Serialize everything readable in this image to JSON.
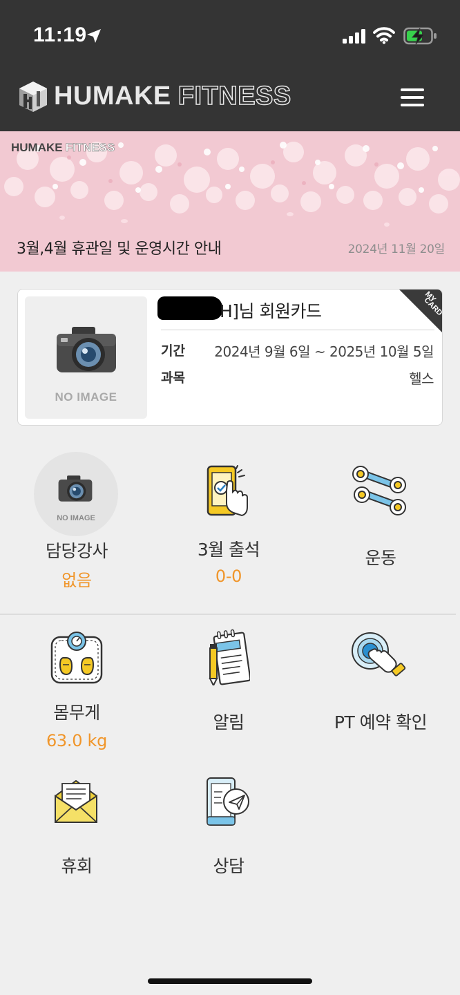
{
  "status_bar": {
    "time": "11:19"
  },
  "header": {
    "logo_text_bold": "HUMAKE",
    "logo_text_light": "FITNESS"
  },
  "banner": {
    "logo_bold": "HUMAKE",
    "logo_light": "FITNESS",
    "title": "3월,4월 휴관일 및 운영시간 안내",
    "date": "2024년 11월 20일"
  },
  "member_card": {
    "no_image": "NO IMAGE",
    "name_suffix": "H]님 회원카드",
    "ribbon_text_1": "MY",
    "ribbon_text_2": "CARD",
    "period_label": "기간",
    "period_value": "2024년 9월 6일 ~ 2025년 10월 5일",
    "subject_label": "과목",
    "subject_value": "헬스"
  },
  "menu": {
    "trainer": {
      "no_image": "NO IMAGE",
      "label": "담당강사",
      "value": "없음"
    },
    "attendance": {
      "label": "3월 출석",
      "value": "0-0"
    },
    "exercise": {
      "label": "운동"
    },
    "weight": {
      "label": "몸무게",
      "value": "63.0 kg"
    },
    "notice": {
      "label": "알림"
    },
    "pt_booking": {
      "label": "PT 예약 확인"
    },
    "leave": {
      "label": "휴회"
    },
    "consult": {
      "label": "상담"
    }
  },
  "colors": {
    "header_bg": "#343434",
    "accent_orange": "#f0962b",
    "banner_pink": "#f2c9d2",
    "page_bg": "#efefef"
  }
}
